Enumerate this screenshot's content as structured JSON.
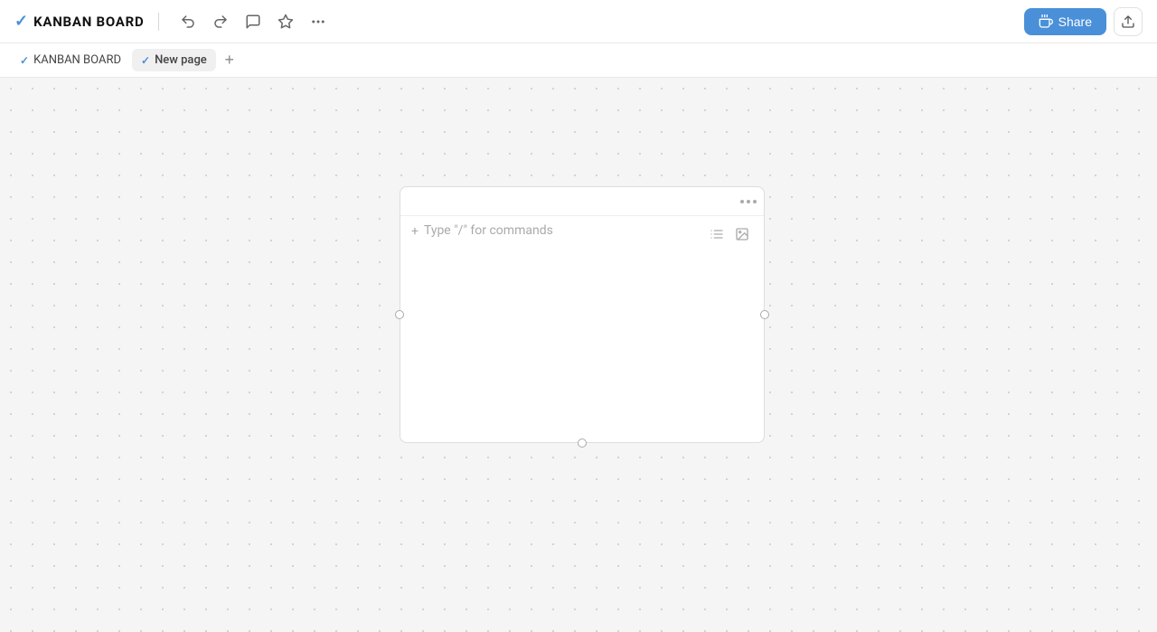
{
  "header": {
    "app_title": "KANBAN BOARD",
    "check_symbol": "✓",
    "toolbar": {
      "undo_label": "undo",
      "redo_label": "redo",
      "comment_label": "comment",
      "star_label": "star",
      "more_label": "more"
    },
    "share_button_label": "Share",
    "export_label": "export"
  },
  "tabs": [
    {
      "id": "kanban",
      "label": "KANBAN BOARD",
      "active": false
    },
    {
      "id": "newpage",
      "label": "New page",
      "active": true
    }
  ],
  "add_tab_label": "+",
  "canvas": {
    "placeholder": "Type \"/\" for commands",
    "plus_icon": "+",
    "dot_menu": "···"
  },
  "colors": {
    "accent": "#4a90d9",
    "border": "#ddd",
    "text_muted": "#aaa",
    "bg": "#f5f5f5"
  }
}
